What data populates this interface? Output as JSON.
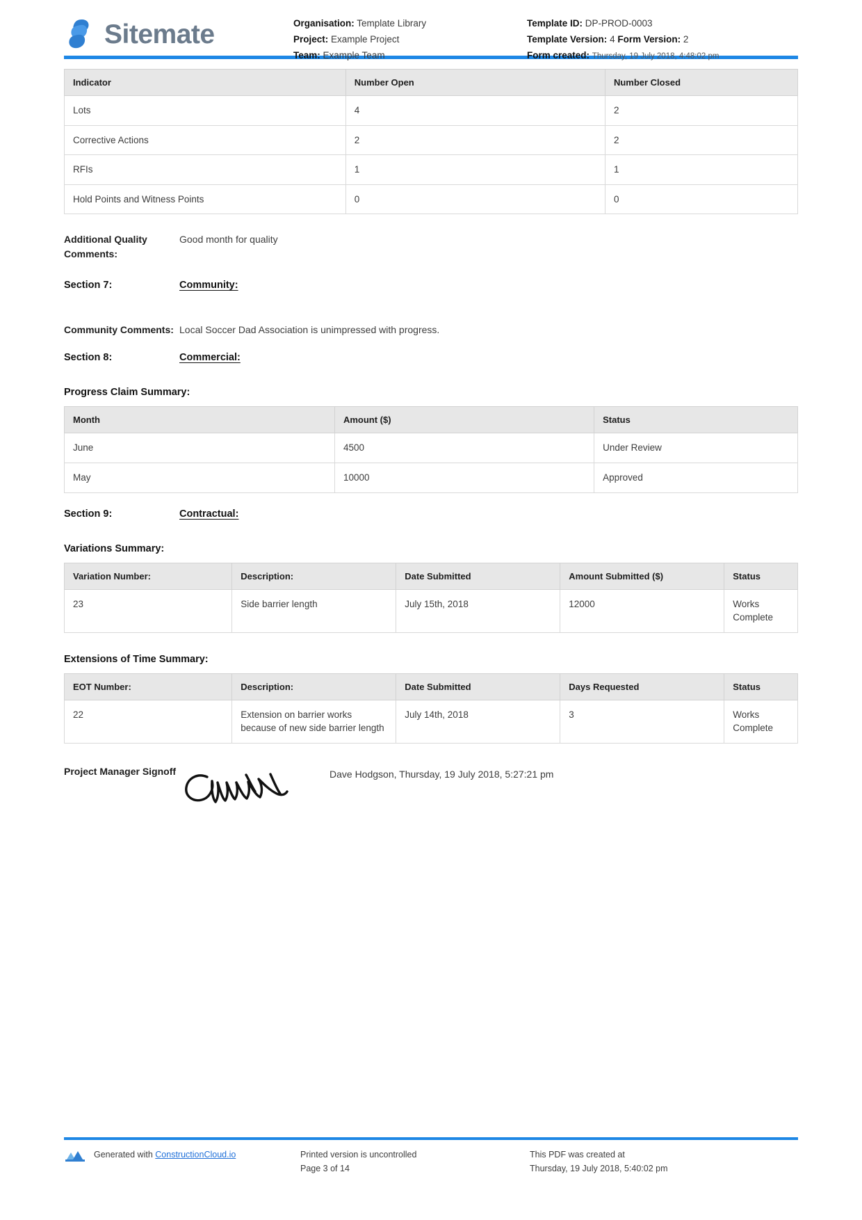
{
  "header": {
    "brand_name": "Sitemate",
    "brand_logo_icon": "sitemate-logo-icon",
    "left_meta": {
      "organisation_label": "Organisation:",
      "organisation_value": "Template Library",
      "project_label": "Project:",
      "project_value": "Example Project",
      "team_label": "Team:",
      "team_value": "Example Team"
    },
    "right_meta": {
      "template_id_label": "Template ID:",
      "template_id_value": "DP-PROD-0003",
      "template_version_label": "Template Version:",
      "template_version_value": "4",
      "form_version_label": "Form Version:",
      "form_version_value": "2",
      "form_created_label": "Form created:",
      "form_created_value": "Thursday, 19 July 2018, 4:48:02 pm"
    }
  },
  "indicator_table": {
    "columns": [
      "Indicator",
      "Number Open",
      "Number Closed"
    ],
    "rows": [
      [
        "Lots",
        "4",
        "2"
      ],
      [
        "Corrective Actions",
        "2",
        "2"
      ],
      [
        "RFIs",
        "1",
        "1"
      ],
      [
        "Hold Points and Witness Points",
        "0",
        "0"
      ]
    ]
  },
  "additional_quality": {
    "label": "Additional Quality Comments:",
    "value": "Good month for quality"
  },
  "section7": {
    "number": "Section 7:",
    "title": "Community:"
  },
  "community": {
    "label": "Community Comments:",
    "value": "Local Soccer Dad Association is unimpressed with progress."
  },
  "section8": {
    "number": "Section 8:",
    "title": "Commercial:"
  },
  "progress_claim": {
    "heading": "Progress Claim Summary:",
    "columns": [
      "Month",
      "Amount ($)",
      "Status"
    ],
    "rows": [
      [
        "June",
        "4500",
        "Under Review"
      ],
      [
        "May",
        "10000",
        "Approved"
      ]
    ]
  },
  "section9": {
    "number": "Section 9:",
    "title": "Contractual:"
  },
  "variations": {
    "heading": "Variations Summary:",
    "columns": [
      "Variation Number:",
      "Description:",
      "Date Submitted",
      "Amount Submitted ($)",
      "Status"
    ],
    "rows": [
      [
        "23",
        "Side barrier length",
        "July 15th, 2018",
        "12000",
        "Works Complete"
      ]
    ]
  },
  "eot": {
    "heading": "Extensions of Time Summary:",
    "columns": [
      "EOT Number:",
      "Description:",
      "Date Submitted",
      "Days Requested",
      "Status"
    ],
    "rows": [
      [
        "22",
        "Extension on barrier works because of new side barrier length",
        "July 14th, 2018",
        "3",
        "Works Complete"
      ]
    ]
  },
  "signoff": {
    "label": "Project Manager Signoff",
    "signature_icon": "handwritten-signature-icon",
    "value": "Dave Hodgson, Thursday, 19 July 2018, 5:27:21 pm"
  },
  "footer": {
    "generated_prefix": "Generated with",
    "generated_link": "ConstructionCloud.io",
    "cc_logo_icon": "constructioncloud-logo-icon",
    "uncontrolled_text": "Printed version is uncontrolled",
    "page_text": "Page 3 of 14",
    "created_text": "This PDF was created at",
    "created_timestamp": "Thursday, 19 July 2018, 5:40:02 pm"
  },
  "colors": {
    "accent_blue": "#1e87e5",
    "link_blue": "#1e6fd9",
    "header_grey": "#e7e7e7"
  }
}
